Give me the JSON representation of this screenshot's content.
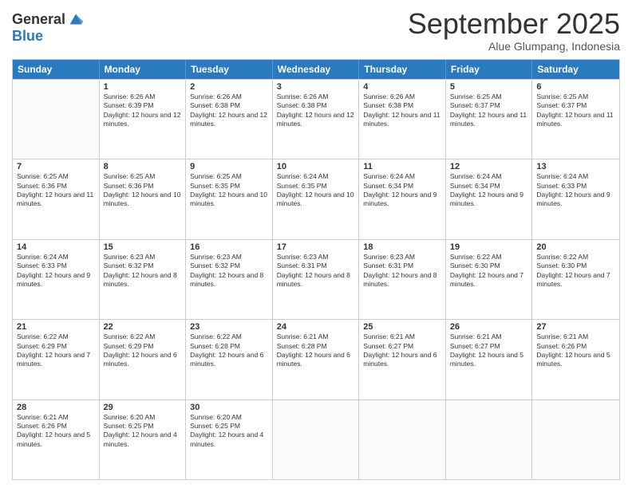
{
  "logo": {
    "general": "General",
    "blue": "Blue"
  },
  "title": "September 2025",
  "subtitle": "Alue Glumpang, Indonesia",
  "days": [
    "Sunday",
    "Monday",
    "Tuesday",
    "Wednesday",
    "Thursday",
    "Friday",
    "Saturday"
  ],
  "weeks": [
    [
      {
        "day": "",
        "empty": true
      },
      {
        "day": "1",
        "sunrise": "6:26 AM",
        "sunset": "6:39 PM",
        "daylight": "12 hours and 12 minutes."
      },
      {
        "day": "2",
        "sunrise": "6:26 AM",
        "sunset": "6:38 PM",
        "daylight": "12 hours and 12 minutes."
      },
      {
        "day": "3",
        "sunrise": "6:26 AM",
        "sunset": "6:38 PM",
        "daylight": "12 hours and 12 minutes."
      },
      {
        "day": "4",
        "sunrise": "6:26 AM",
        "sunset": "6:38 PM",
        "daylight": "12 hours and 11 minutes."
      },
      {
        "day": "5",
        "sunrise": "6:25 AM",
        "sunset": "6:37 PM",
        "daylight": "12 hours and 11 minutes."
      },
      {
        "day": "6",
        "sunrise": "6:25 AM",
        "sunset": "6:37 PM",
        "daylight": "12 hours and 11 minutes."
      }
    ],
    [
      {
        "day": "7",
        "sunrise": "6:25 AM",
        "sunset": "6:36 PM",
        "daylight": "12 hours and 11 minutes."
      },
      {
        "day": "8",
        "sunrise": "6:25 AM",
        "sunset": "6:36 PM",
        "daylight": "12 hours and 10 minutes."
      },
      {
        "day": "9",
        "sunrise": "6:25 AM",
        "sunset": "6:35 PM",
        "daylight": "12 hours and 10 minutes."
      },
      {
        "day": "10",
        "sunrise": "6:24 AM",
        "sunset": "6:35 PM",
        "daylight": "12 hours and 10 minutes."
      },
      {
        "day": "11",
        "sunrise": "6:24 AM",
        "sunset": "6:34 PM",
        "daylight": "12 hours and 9 minutes."
      },
      {
        "day": "12",
        "sunrise": "6:24 AM",
        "sunset": "6:34 PM",
        "daylight": "12 hours and 9 minutes."
      },
      {
        "day": "13",
        "sunrise": "6:24 AM",
        "sunset": "6:33 PM",
        "daylight": "12 hours and 9 minutes."
      }
    ],
    [
      {
        "day": "14",
        "sunrise": "6:24 AM",
        "sunset": "6:33 PM",
        "daylight": "12 hours and 9 minutes."
      },
      {
        "day": "15",
        "sunrise": "6:23 AM",
        "sunset": "6:32 PM",
        "daylight": "12 hours and 8 minutes."
      },
      {
        "day": "16",
        "sunrise": "6:23 AM",
        "sunset": "6:32 PM",
        "daylight": "12 hours and 8 minutes."
      },
      {
        "day": "17",
        "sunrise": "6:23 AM",
        "sunset": "6:31 PM",
        "daylight": "12 hours and 8 minutes."
      },
      {
        "day": "18",
        "sunrise": "6:23 AM",
        "sunset": "6:31 PM",
        "daylight": "12 hours and 8 minutes."
      },
      {
        "day": "19",
        "sunrise": "6:22 AM",
        "sunset": "6:30 PM",
        "daylight": "12 hours and 7 minutes."
      },
      {
        "day": "20",
        "sunrise": "6:22 AM",
        "sunset": "6:30 PM",
        "daylight": "12 hours and 7 minutes."
      }
    ],
    [
      {
        "day": "21",
        "sunrise": "6:22 AM",
        "sunset": "6:29 PM",
        "daylight": "12 hours and 7 minutes."
      },
      {
        "day": "22",
        "sunrise": "6:22 AM",
        "sunset": "6:29 PM",
        "daylight": "12 hours and 6 minutes."
      },
      {
        "day": "23",
        "sunrise": "6:22 AM",
        "sunset": "6:28 PM",
        "daylight": "12 hours and 6 minutes."
      },
      {
        "day": "24",
        "sunrise": "6:21 AM",
        "sunset": "6:28 PM",
        "daylight": "12 hours and 6 minutes."
      },
      {
        "day": "25",
        "sunrise": "6:21 AM",
        "sunset": "6:27 PM",
        "daylight": "12 hours and 6 minutes."
      },
      {
        "day": "26",
        "sunrise": "6:21 AM",
        "sunset": "6:27 PM",
        "daylight": "12 hours and 5 minutes."
      },
      {
        "day": "27",
        "sunrise": "6:21 AM",
        "sunset": "6:26 PM",
        "daylight": "12 hours and 5 minutes."
      }
    ],
    [
      {
        "day": "28",
        "sunrise": "6:21 AM",
        "sunset": "6:26 PM",
        "daylight": "12 hours and 5 minutes."
      },
      {
        "day": "29",
        "sunrise": "6:20 AM",
        "sunset": "6:25 PM",
        "daylight": "12 hours and 4 minutes."
      },
      {
        "day": "30",
        "sunrise": "6:20 AM",
        "sunset": "6:25 PM",
        "daylight": "12 hours and 4 minutes."
      },
      {
        "day": "",
        "empty": true
      },
      {
        "day": "",
        "empty": true
      },
      {
        "day": "",
        "empty": true
      },
      {
        "day": "",
        "empty": true
      }
    ]
  ]
}
